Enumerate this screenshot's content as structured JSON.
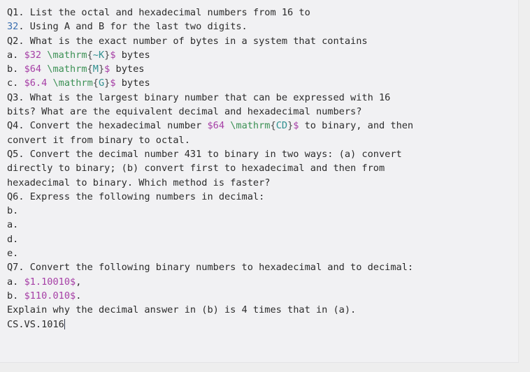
{
  "editor": {
    "background_color": "#f1f1f3",
    "text_color": "#2b2b2b",
    "colors": {
      "plain": "#2b2b2b",
      "number": "#3a6fb0",
      "math_delimiter": "#a63fa6",
      "latex_command": "#3c9155",
      "latex_argument": "#2f8f8f",
      "brace": "#4a4a4a",
      "caret": "#333a4d"
    },
    "caret_visible": true,
    "lines": [
      {
        "id": "line-1",
        "segments": [
          {
            "text": "Q1. List the octal and hexadecimal numbers from 16 to",
            "style": "plain"
          }
        ]
      },
      {
        "id": "line-2",
        "segments": [
          {
            "text": "32",
            "style": "number"
          },
          {
            "text": ". Using A and B for the last two digits.",
            "style": "plain"
          }
        ]
      },
      {
        "id": "line-3",
        "segments": [
          {
            "text": "Q2. What is the exact number of bytes in a system that contains",
            "style": "plain"
          }
        ]
      },
      {
        "id": "line-4",
        "segments": [
          {
            "text": "a. ",
            "style": "plain"
          },
          {
            "text": "$32",
            "style": "math_delimiter"
          },
          {
            "text": " \\mathrm",
            "style": "latex_command"
          },
          {
            "text": "{",
            "style": "brace"
          },
          {
            "text": "~K",
            "style": "latex_argument"
          },
          {
            "text": "}",
            "style": "brace"
          },
          {
            "text": "$",
            "style": "math_delimiter"
          },
          {
            "text": " bytes",
            "style": "plain"
          }
        ]
      },
      {
        "id": "line-5",
        "segments": [
          {
            "text": "b. ",
            "style": "plain"
          },
          {
            "text": "$64",
            "style": "math_delimiter"
          },
          {
            "text": " \\mathrm",
            "style": "latex_command"
          },
          {
            "text": "{",
            "style": "brace"
          },
          {
            "text": "M",
            "style": "latex_argument"
          },
          {
            "text": "}",
            "style": "brace"
          },
          {
            "text": "$",
            "style": "math_delimiter"
          },
          {
            "text": " bytes",
            "style": "plain"
          }
        ]
      },
      {
        "id": "line-6",
        "segments": [
          {
            "text": "c. ",
            "style": "plain"
          },
          {
            "text": "$6.4",
            "style": "math_delimiter"
          },
          {
            "text": " \\mathrm",
            "style": "latex_command"
          },
          {
            "text": "{",
            "style": "brace"
          },
          {
            "text": "G",
            "style": "latex_argument"
          },
          {
            "text": "}",
            "style": "brace"
          },
          {
            "text": "$",
            "style": "math_delimiter"
          },
          {
            "text": " bytes",
            "style": "plain"
          }
        ]
      },
      {
        "id": "line-7",
        "segments": [
          {
            "text": "Q3. What is the largest binary number that can be expressed with 16",
            "style": "plain"
          }
        ]
      },
      {
        "id": "line-8",
        "segments": [
          {
            "text": "bits? What are the equivalent decimal and hexadecimal numbers?",
            "style": "plain"
          }
        ]
      },
      {
        "id": "line-9",
        "segments": [
          {
            "text": "Q4. Convert the hexadecimal number ",
            "style": "plain"
          },
          {
            "text": "$64",
            "style": "math_delimiter"
          },
          {
            "text": " \\mathrm",
            "style": "latex_command"
          },
          {
            "text": "{",
            "style": "brace"
          },
          {
            "text": "CD",
            "style": "latex_argument"
          },
          {
            "text": "}",
            "style": "brace"
          },
          {
            "text": "$",
            "style": "math_delimiter"
          },
          {
            "text": " to binary, and then",
            "style": "plain"
          }
        ]
      },
      {
        "id": "line-10",
        "segments": [
          {
            "text": "convert it from binary to octal.",
            "style": "plain"
          }
        ]
      },
      {
        "id": "line-11",
        "segments": [
          {
            "text": "Q5. Convert the decimal number 431 to binary in two ways: (a) convert",
            "style": "plain"
          }
        ]
      },
      {
        "id": "line-12",
        "segments": [
          {
            "text": "directly to binary; (b) convert first to hexadecimal and then from",
            "style": "plain"
          }
        ]
      },
      {
        "id": "line-13",
        "segments": [
          {
            "text": "hexadecimal to binary. Which method is faster?",
            "style": "plain"
          }
        ]
      },
      {
        "id": "line-14",
        "segments": [
          {
            "text": "Q6. Express the following numbers in decimal:",
            "style": "plain"
          }
        ]
      },
      {
        "id": "line-15",
        "segments": [
          {
            "text": "b.",
            "style": "plain"
          }
        ]
      },
      {
        "id": "line-16",
        "segments": [
          {
            "text": "a.",
            "style": "plain"
          }
        ]
      },
      {
        "id": "line-17",
        "segments": [
          {
            "text": "d.",
            "style": "plain"
          }
        ]
      },
      {
        "id": "line-18",
        "segments": [
          {
            "text": "e.",
            "style": "plain"
          }
        ]
      },
      {
        "id": "line-19",
        "segments": [
          {
            "text": "Q7. Convert the following binary numbers to hexadecimal and to decimal:",
            "style": "plain"
          }
        ]
      },
      {
        "id": "line-20",
        "segments": [
          {
            "text": "a. ",
            "style": "plain"
          },
          {
            "text": "$1.10010$",
            "style": "math_delimiter"
          },
          {
            "text": ",",
            "style": "plain"
          }
        ]
      },
      {
        "id": "line-21",
        "segments": [
          {
            "text": "b. ",
            "style": "plain"
          },
          {
            "text": "$110.010$",
            "style": "math_delimiter"
          },
          {
            "text": ".",
            "style": "plain"
          }
        ]
      },
      {
        "id": "line-22",
        "segments": [
          {
            "text": "Explain why the decimal answer in (b) is 4 times that in (a).",
            "style": "plain"
          }
        ]
      },
      {
        "id": "line-23",
        "segments": [
          {
            "text": "CS.VS.1016",
            "style": "plain"
          }
        ],
        "caret_after": true
      }
    ]
  }
}
